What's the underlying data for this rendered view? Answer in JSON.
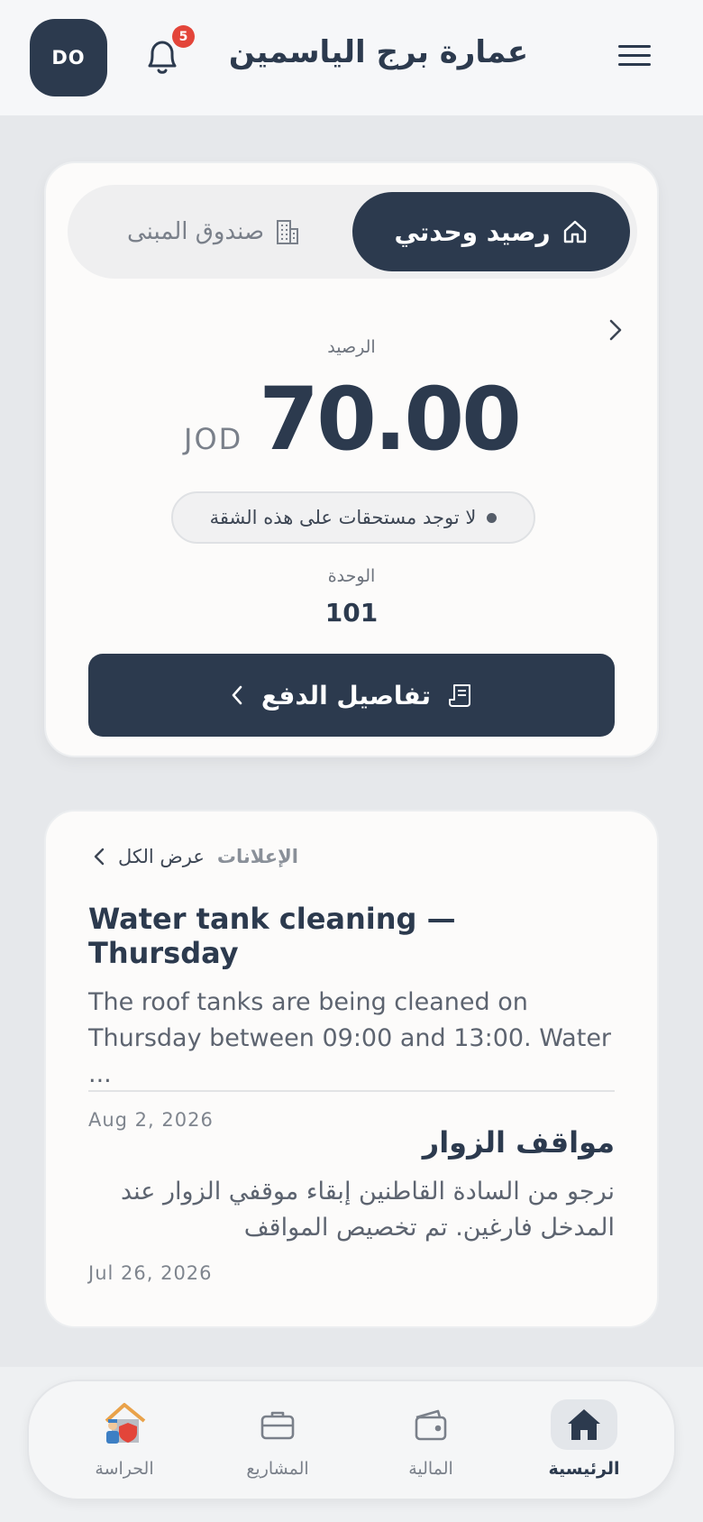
{
  "header": {
    "avatar_initials": "DO",
    "notification_count": "5",
    "title": "عمارة برج الياسمين"
  },
  "balance": {
    "tab_active": "رصيد وحدتي",
    "tab_inactive": "صندوق المبنى",
    "label": "الرصيد",
    "amount": "70.00",
    "currency": "JOD",
    "status": "لا توجد مستحقات على هذه الشقة",
    "unit_label": "الوحدة",
    "unit_value": "101",
    "pay_button": "تفاصيل الدفع"
  },
  "announcements": {
    "title": "الإعلانات",
    "view_all": "عرض الكل",
    "items": [
      {
        "title": "Water tank cleaning — Thursday",
        "body": "The roof tanks are being cleaned on Thursday between 09:00 and 13:00. Water ...",
        "date": "Aug 2, 2026"
      },
      {
        "title": "مواقف الزوار",
        "body": "نرجو من السادة القاطنين إبقاء موقفي الزوار عند المدخل فارغين. تم تخصيص المواقف",
        "date": "Jul 26, 2026"
      }
    ]
  },
  "nav": {
    "items": [
      {
        "label": "الرئيسية",
        "icon": "home-icon",
        "active": true
      },
      {
        "label": "المالية",
        "icon": "wallet-icon",
        "active": false
      },
      {
        "label": "المشاريع",
        "icon": "briefcase-icon",
        "active": false
      },
      {
        "label": "الحراسة",
        "icon": "guard-house-icon",
        "active": false
      }
    ]
  },
  "colors": {
    "primary": "#2c3a4e",
    "badge": "#e3453a",
    "background": "#e6e8eb"
  }
}
